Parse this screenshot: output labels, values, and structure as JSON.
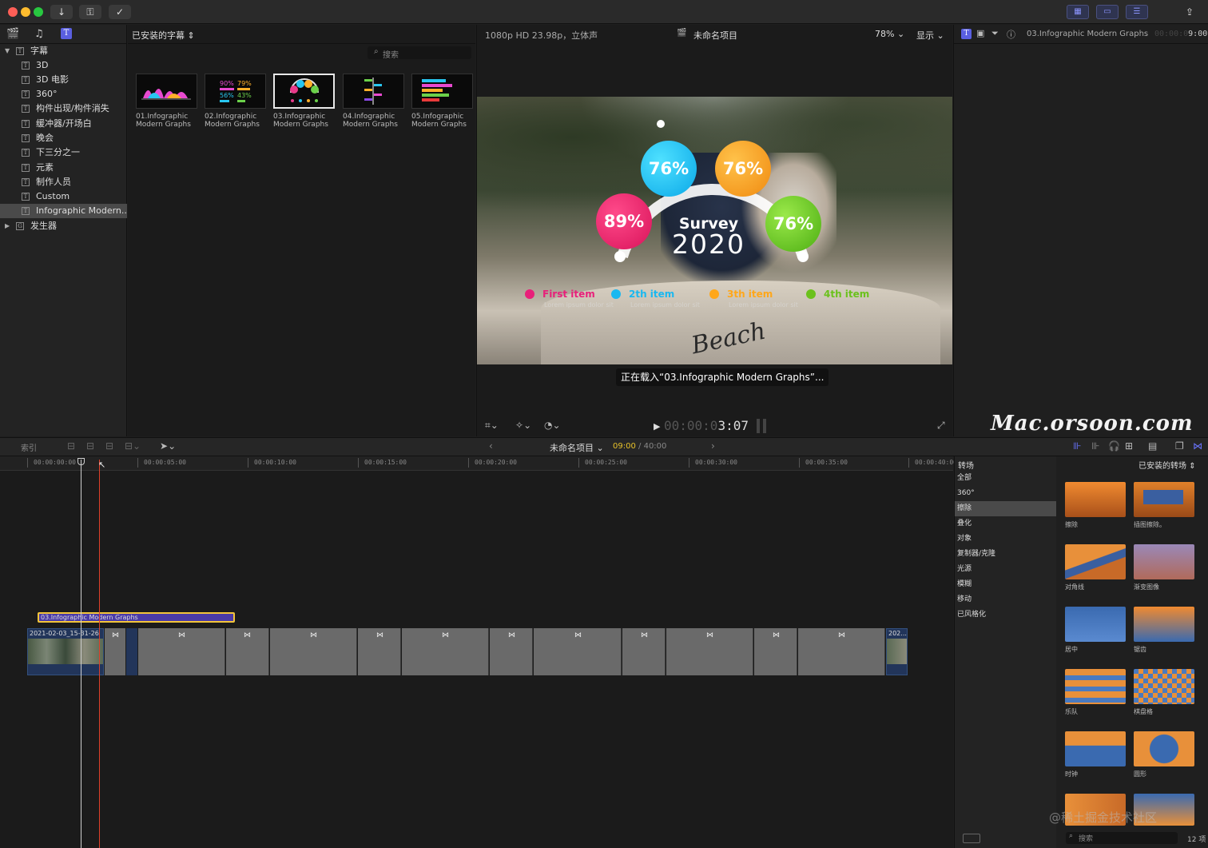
{
  "toolbar": {
    "import_icon": "down-arrow-icon",
    "keywords_icon": "key-icon",
    "check_icon": "checkmark-icon",
    "share_icon": "share-icon"
  },
  "sidebar": {
    "items": [
      {
        "label": "字幕",
        "icon": "T"
      },
      {
        "label": "3D",
        "icon": "T"
      },
      {
        "label": "3D 电影",
        "icon": "T"
      },
      {
        "label": "360°",
        "icon": "T"
      },
      {
        "label": "构件出现/构件消失",
        "icon": "T"
      },
      {
        "label": "缓冲器/开场白",
        "icon": "T"
      },
      {
        "label": "晚会",
        "icon": "T"
      },
      {
        "label": "下三分之一",
        "icon": "T"
      },
      {
        "label": "元素",
        "icon": "T"
      },
      {
        "label": "制作人员",
        "icon": "T"
      },
      {
        "label": "Custom",
        "icon": "T"
      },
      {
        "label": "Infographic Modern...",
        "icon": "T"
      },
      {
        "label": "发生器",
        "icon": "G"
      }
    ]
  },
  "browser": {
    "title": "已安装的字幕",
    "search_placeholder": "搜索",
    "items": [
      {
        "line1": "01.Infographic",
        "line2": "Modern Graphs"
      },
      {
        "line1": "02.Infographic",
        "line2": "Modern Graphs"
      },
      {
        "line1": "03.Infographic",
        "line2": "Modern Graphs"
      },
      {
        "line1": "04.Infographic",
        "line2": "Modern Graphs"
      },
      {
        "line1": "05.Infographic",
        "line2": "Modern Graphs"
      }
    ]
  },
  "viewer": {
    "format": "1080p HD 23.98p，立体声",
    "project": "未命名项目",
    "zoom": "78%",
    "display": "显示",
    "loading": "正在载入“03.Infographic Modern Graphs”...",
    "timecode_dim": "00:00:0",
    "timecode": "3:07",
    "overlay": {
      "bubbles": [
        "76%",
        "76%",
        "89%",
        "76%"
      ],
      "survey": "Survey",
      "year": "2020",
      "items": [
        "First item",
        "2th item",
        "3th item",
        "4th item"
      ],
      "lorem": "Lorem ipsum dolor sit",
      "beach": "Beach"
    }
  },
  "inspector": {
    "title": "03.Infographic Modern Graphs",
    "time_dim": "00:00:0",
    "time": "9:00"
  },
  "watermark": "Mac.orsoon.com",
  "timeline_bar": {
    "index": "索引",
    "project": "未命名项目",
    "current": "09:00",
    "total": "40:00",
    "separator": "/"
  },
  "ruler": [
    "00:00:00:00",
    "00:00:05:00",
    "00:00:10:00",
    "00:00:15:00",
    "00:00:20:00",
    "00:00:25:00",
    "00:00:30:00",
    "00:00:35:00",
    "00:00:40:00"
  ],
  "clips": {
    "title_clip": "03.Infographic Modern Graphs",
    "clip1": "2021-02-03_15-31-26",
    "clip_end": "202..."
  },
  "transitions": {
    "header": "转场",
    "installed": "已安装的转场",
    "search": "搜索",
    "count": "12 项",
    "categories": [
      "全部",
      "360°",
      "擦除",
      "叠化",
      "对象",
      "复制器/克隆",
      "光源",
      "模糊",
      "移动",
      "已风格化"
    ],
    "items": [
      "擦除",
      "插图擦除。",
      "对角线",
      "渐变图像",
      "居中",
      "锯齿",
      "乐队",
      "棋盘格",
      "时钟",
      "圆形"
    ]
  },
  "community_watermark": "@稀土掘金技术社区"
}
